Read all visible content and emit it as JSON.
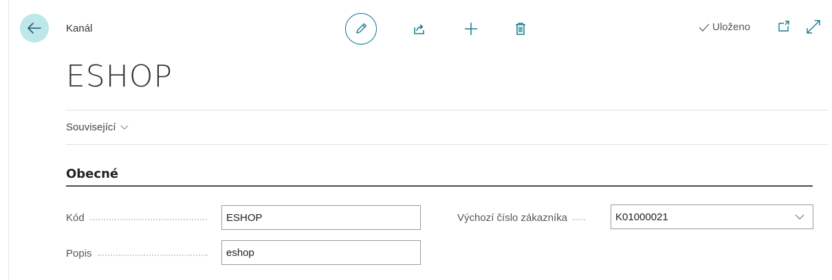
{
  "header": {
    "entity_label": "Kanál",
    "saved_label": "Uloženo"
  },
  "icons": {
    "back": "arrow-left-icon",
    "edit": "pencil-icon",
    "share": "share-icon",
    "new": "plus-icon",
    "delete": "trash-icon",
    "saved": "checkmark-icon",
    "open_new_window": "open-in-new-window-icon",
    "expand": "expand-icon"
  },
  "page": {
    "title": "ESHOP"
  },
  "menu": {
    "related_label": "Související"
  },
  "section": {
    "title": "Obecné"
  },
  "fields": {
    "code_label": "Kód",
    "code_value": "ESHOP",
    "description_label": "Popis",
    "description_value": "eshop",
    "customer_label": "Výchozí číslo zákazníka",
    "customer_value": "K01000021"
  },
  "colors": {
    "accent": "#0f7c8c",
    "back_button_bg": "#bde7ea"
  }
}
